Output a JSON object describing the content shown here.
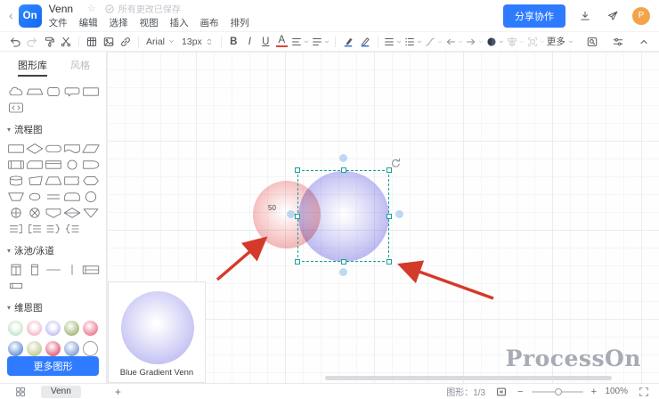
{
  "header": {
    "back_icon": "‹",
    "logo_text": "On",
    "title": "Venn",
    "star_icon": "☆",
    "save_status": "所有更改已保存",
    "menus": [
      "文件",
      "编辑",
      "选择",
      "视图",
      "插入",
      "画布",
      "排列"
    ],
    "share_button": "分享协作",
    "avatar_initial": "P"
  },
  "toolbar": {
    "font_family": "Arial",
    "font_size": "13px",
    "bold_label": "B",
    "italic_label": "I",
    "underline_label": "U",
    "font_color_label": "A",
    "more_label": "更多"
  },
  "sidebar": {
    "tabs": [
      {
        "label": "图形库",
        "active": true
      },
      {
        "label": "风格",
        "active": false
      }
    ],
    "recent_shapes": [
      "cloud",
      "trapezoid2",
      "rounded-square",
      "callout",
      "rectangle",
      "code-block"
    ],
    "sections": [
      {
        "title": "流程图",
        "shapes": [
          "rectangle",
          "diamond",
          "stadium",
          "document",
          "parallelogram",
          "predefined-process",
          "card",
          "internal-storage",
          "circle",
          "delay",
          "database",
          "manual-operation",
          "trapezoid",
          "torn-paper",
          "hexagon",
          "trapezoid-down",
          "ellipse",
          "double-line",
          "half-stadium",
          "circle-large",
          "circle-plus",
          "circle-cross",
          "shield",
          "diamond-line",
          "triangle-down",
          "list-right-bracket",
          "list-left-bracket",
          "list-right-brace",
          "list-left-brace"
        ]
      },
      {
        "title": "泳池/泳道",
        "shapes": [
          "pool-vertical",
          "lane-vertical",
          "horizontal-line",
          "vertical-line",
          "pool-horizontal",
          "lane-horizontal"
        ]
      },
      {
        "title": "维恩图",
        "palette": [
          {
            "style": "ring",
            "color": "#b7dfb9"
          },
          {
            "style": "ring",
            "color": "#f2a8bc"
          },
          {
            "style": "ring",
            "color": "#b3b3ef"
          },
          {
            "style": "solid",
            "color": "#a9bd82"
          },
          {
            "style": "solid",
            "color": "#ec8399"
          },
          {
            "style": "solid",
            "color": "#6b96d8"
          },
          {
            "style": "solid",
            "color": "#c3cf96"
          },
          {
            "style": "solid",
            "color": "#e26a82"
          },
          {
            "style": "solid",
            "color": "#86a4d8"
          },
          {
            "style": "outline",
            "color": "#9aa0a8"
          }
        ]
      }
    ],
    "more_shapes_button": "更多图形"
  },
  "canvas": {
    "venn_label": "50",
    "left_circle_color": "#ee9d9d",
    "right_circle_color": "#a39fe9",
    "selection_color": "#18a096",
    "arrow_color": "#d43a2a",
    "preview_caption": "Blue Gradient Venn",
    "watermark": "ProcessOn"
  },
  "footer": {
    "page_tab": "Venn",
    "add_label": "+",
    "shape_count": "图形：1/3",
    "zoom_out": "−",
    "zoom_in": "+",
    "zoom_level": "100%"
  }
}
